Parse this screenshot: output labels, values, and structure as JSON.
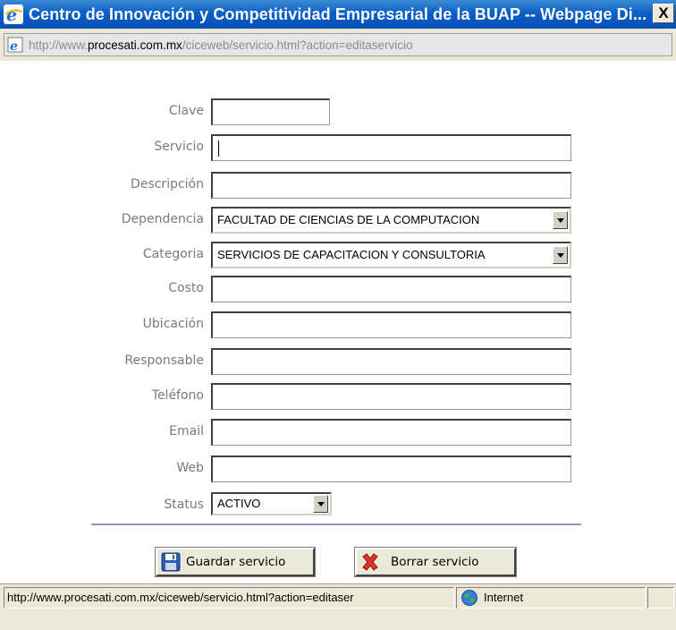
{
  "window": {
    "title": "Centro de Innovación y Competitividad Empresarial de la BUAP -- Webpage Di...",
    "close_label": "X"
  },
  "address": {
    "prefix": "http://www.",
    "domain": "procesati.com.mx",
    "path": "/ciceweb/servicio.html?action=editaservicio"
  },
  "form": {
    "clave": {
      "label": "Clave",
      "value": ""
    },
    "servicio": {
      "label": "Servicio",
      "value": ""
    },
    "descripcion": {
      "label": "Descripción",
      "value": ""
    },
    "dependencia": {
      "label": "Dependencia",
      "selected": "FACULTAD DE CIENCIAS DE LA COMPUTACION"
    },
    "categoria": {
      "label": "Categoria",
      "selected": "SERVICIOS DE CAPACITACION Y CONSULTORIA"
    },
    "costo": {
      "label": "Costo",
      "value": ""
    },
    "ubicacion": {
      "label": "Ubicación",
      "value": ""
    },
    "responsable": {
      "label": "Responsable",
      "value": ""
    },
    "telefono": {
      "label": "Teléfono",
      "value": ""
    },
    "email": {
      "label": "Email",
      "value": ""
    },
    "web": {
      "label": "Web",
      "value": ""
    },
    "status": {
      "label": "Status",
      "selected": "ACTIVO"
    }
  },
  "buttons": {
    "save_label": "Guardar servicio",
    "delete_label": "Borrar servicio"
  },
  "statusbar": {
    "url": "http://www.procesati.com.mx/ciceweb/servicio.html?action=editaser",
    "zone": "Internet"
  },
  "colors": {
    "titlebar": "#0a5fc7",
    "chrome": "#ece9d8",
    "label": "#7a7a7a",
    "divider": "#8a9ac8"
  }
}
